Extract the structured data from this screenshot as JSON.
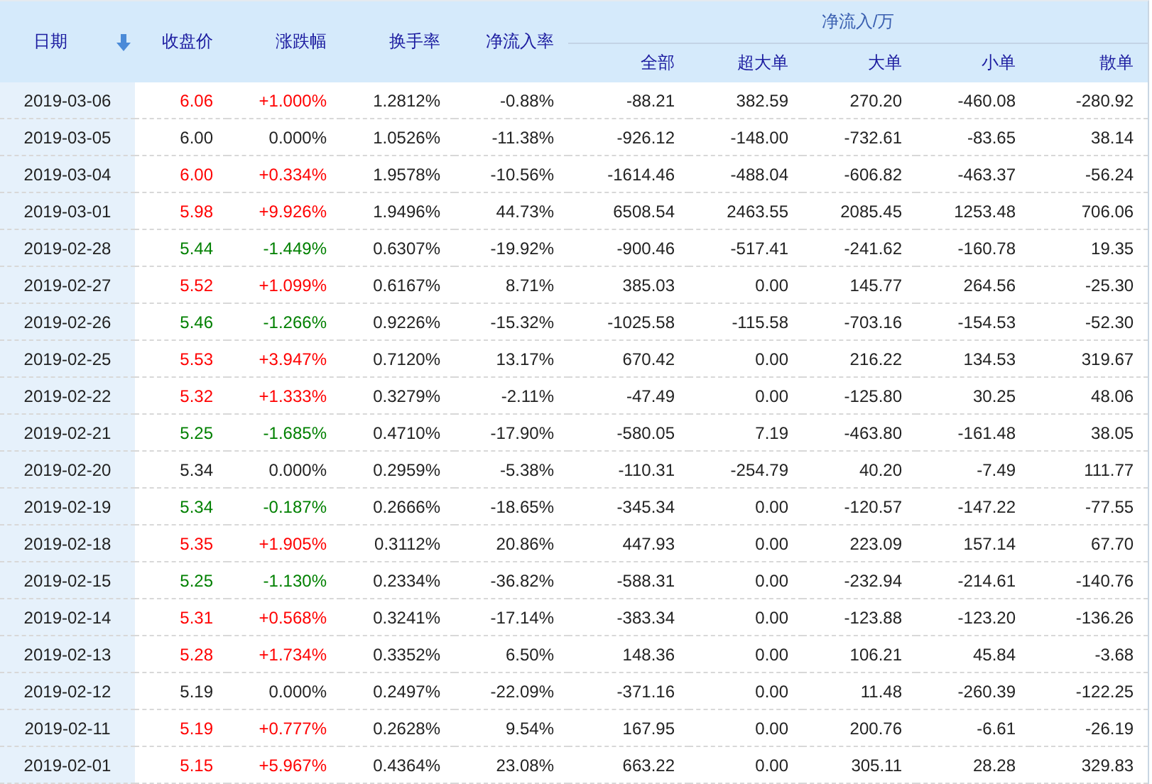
{
  "table": {
    "columns": [
      {
        "label": "日期",
        "sorted": true
      },
      {
        "label": "收盘价",
        "sorted": false
      },
      {
        "label": "涨跌幅",
        "sorted": false
      },
      {
        "label": "换手率",
        "sorted": false
      },
      {
        "label": "净流入率",
        "sorted": false
      }
    ],
    "group": {
      "label": "净流入/万",
      "columns": [
        "全部",
        "超大单",
        "大单",
        "小单",
        "散单"
      ]
    },
    "rows": [
      {
        "color": "#ff0000",
        "cells": [
          "2019-03-06",
          "6.06",
          "+1.000%",
          "1.2812%",
          "-0.88%",
          "-88.21",
          "382.59",
          "270.20",
          "-460.08",
          "-280.92"
        ]
      },
      {
        "color": "#222222",
        "cells": [
          "2019-03-05",
          "6.00",
          "0.000%",
          "1.0526%",
          "-11.38%",
          "-926.12",
          "-148.00",
          "-732.61",
          "-83.65",
          "38.14"
        ]
      },
      {
        "color": "#ff0000",
        "cells": [
          "2019-03-04",
          "6.00",
          "+0.334%",
          "1.9578%",
          "-10.56%",
          "-1614.46",
          "-488.04",
          "-606.82",
          "-463.37",
          "-56.24"
        ]
      },
      {
        "color": "#ff0000",
        "cells": [
          "2019-03-01",
          "5.98",
          "+9.926%",
          "1.9496%",
          "44.73%",
          "6508.54",
          "2463.55",
          "2085.45",
          "1253.48",
          "706.06"
        ]
      },
      {
        "color": "#008000",
        "cells": [
          "2019-02-28",
          "5.44",
          "-1.449%",
          "0.6307%",
          "-19.92%",
          "-900.46",
          "-517.41",
          "-241.62",
          "-160.78",
          "19.35"
        ]
      },
      {
        "color": "#ff0000",
        "cells": [
          "2019-02-27",
          "5.52",
          "+1.099%",
          "0.6167%",
          "8.71%",
          "385.03",
          "0.00",
          "145.77",
          "264.56",
          "-25.30"
        ]
      },
      {
        "color": "#008000",
        "cells": [
          "2019-02-26",
          "5.46",
          "-1.266%",
          "0.9226%",
          "-15.32%",
          "-1025.58",
          "-115.58",
          "-703.16",
          "-154.53",
          "-52.30"
        ]
      },
      {
        "color": "#ff0000",
        "cells": [
          "2019-02-25",
          "5.53",
          "+3.947%",
          "0.7120%",
          "13.17%",
          "670.42",
          "0.00",
          "216.22",
          "134.53",
          "319.67"
        ]
      },
      {
        "color": "#ff0000",
        "cells": [
          "2019-02-22",
          "5.32",
          "+1.333%",
          "0.3279%",
          "-2.11%",
          "-47.49",
          "0.00",
          "-125.80",
          "30.25",
          "48.06"
        ]
      },
      {
        "color": "#008000",
        "cells": [
          "2019-02-21",
          "5.25",
          "-1.685%",
          "0.4710%",
          "-17.90%",
          "-580.05",
          "7.19",
          "-463.80",
          "-161.48",
          "38.05"
        ]
      },
      {
        "color": "#222222",
        "cells": [
          "2019-02-20",
          "5.34",
          "0.000%",
          "0.2959%",
          "-5.38%",
          "-110.31",
          "-254.79",
          "40.20",
          "-7.49",
          "111.77"
        ]
      },
      {
        "color": "#008000",
        "cells": [
          "2019-02-19",
          "5.34",
          "-0.187%",
          "0.2666%",
          "-18.65%",
          "-345.34",
          "0.00",
          "-120.57",
          "-147.22",
          "-77.55"
        ]
      },
      {
        "color": "#ff0000",
        "cells": [
          "2019-02-18",
          "5.35",
          "+1.905%",
          "0.3112%",
          "20.86%",
          "447.93",
          "0.00",
          "223.09",
          "157.14",
          "67.70"
        ]
      },
      {
        "color": "#008000",
        "cells": [
          "2019-02-15",
          "5.25",
          "-1.130%",
          "0.2334%",
          "-36.82%",
          "-588.31",
          "0.00",
          "-232.94",
          "-214.61",
          "-140.76"
        ]
      },
      {
        "color": "#ff0000",
        "cells": [
          "2019-02-14",
          "5.31",
          "+0.568%",
          "0.3241%",
          "-17.14%",
          "-383.34",
          "0.00",
          "-123.88",
          "-123.20",
          "-136.26"
        ]
      },
      {
        "color": "#ff0000",
        "cells": [
          "2019-02-13",
          "5.28",
          "+1.734%",
          "0.3352%",
          "6.50%",
          "148.36",
          "0.00",
          "106.21",
          "45.84",
          "-3.68"
        ]
      },
      {
        "color": "#222222",
        "cells": [
          "2019-02-12",
          "5.19",
          "0.000%",
          "0.2497%",
          "-22.09%",
          "-371.16",
          "0.00",
          "11.48",
          "-260.39",
          "-122.25"
        ]
      },
      {
        "color": "#ff0000",
        "cells": [
          "2019-02-11",
          "5.19",
          "+0.777%",
          "0.2628%",
          "9.54%",
          "167.95",
          "0.00",
          "200.76",
          "-6.61",
          "-26.19"
        ]
      },
      {
        "color": "#ff0000",
        "cells": [
          "2019-02-01",
          "5.15",
          "+5.967%",
          "0.4364%",
          "23.08%",
          "663.22",
          "0.00",
          "305.11",
          "28.28",
          "329.83"
        ]
      }
    ]
  }
}
